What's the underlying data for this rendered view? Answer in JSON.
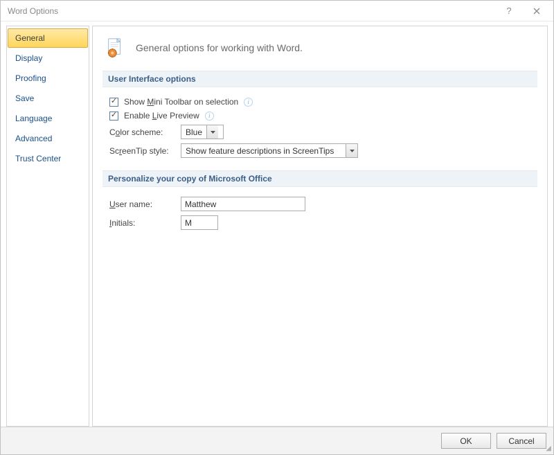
{
  "window": {
    "title": "Word Options"
  },
  "nav": {
    "items": [
      "General",
      "Display",
      "Proofing",
      "Save",
      "Language",
      "Advanced",
      "Trust Center"
    ],
    "selectedIndex": 0
  },
  "header": {
    "text": "General options for working with Word."
  },
  "sections": {
    "ui": {
      "title": "User Interface options",
      "miniToolbar": {
        "checked": true,
        "prefix": "Show ",
        "mid": "M",
        "suffix": "ini Toolbar on selection"
      },
      "livePreview": {
        "checked": true,
        "prefix": "Enable ",
        "mid": "L",
        "suffix": "ive Preview"
      },
      "colorScheme": {
        "labelPre": "C",
        "labelMid": "o",
        "labelPost": "lor scheme:",
        "value": "Blue"
      },
      "screenTip": {
        "labelPre": "Sc",
        "labelMid": "r",
        "labelPost": "eenTip style:",
        "value": "Show feature descriptions in ScreenTips"
      }
    },
    "personalize": {
      "title": "Personalize your copy of Microsoft Office",
      "username": {
        "labelMid": "U",
        "labelPost": "ser name:",
        "value": "Matthew"
      },
      "initials": {
        "labelMid": "I",
        "labelPost": "nitials:",
        "value": "M"
      }
    }
  },
  "footer": {
    "ok": "OK",
    "cancel": "Cancel"
  }
}
